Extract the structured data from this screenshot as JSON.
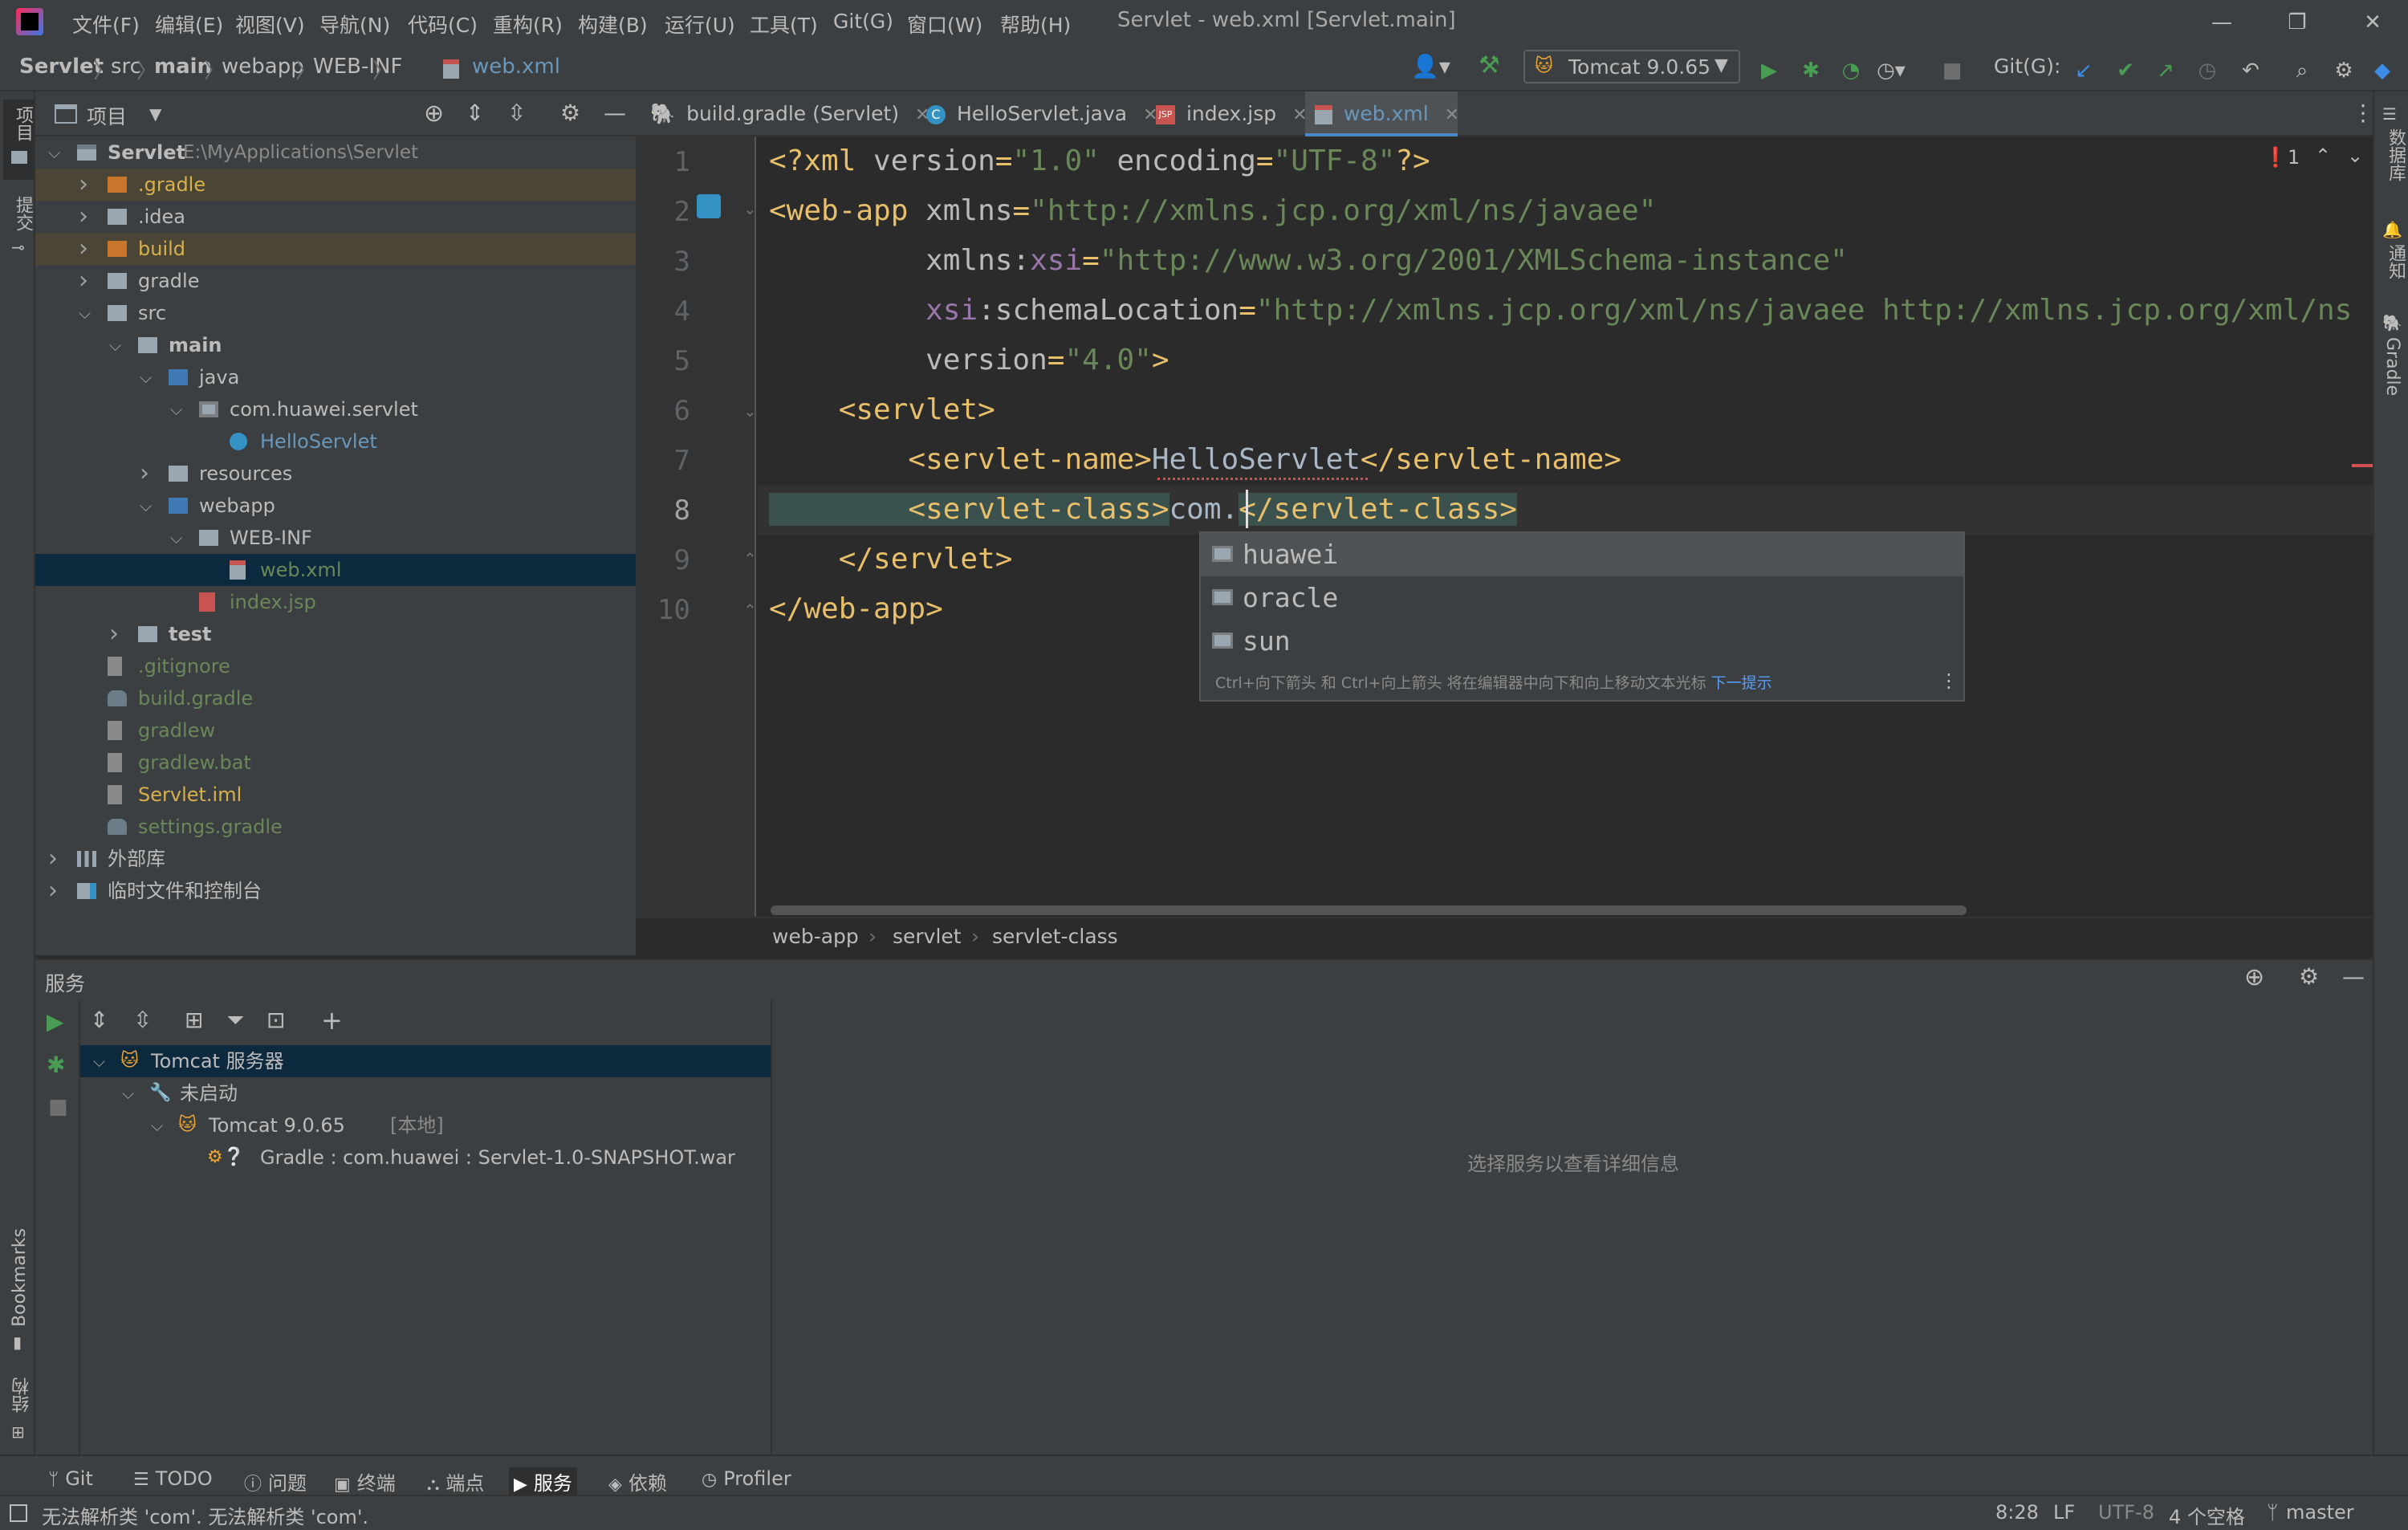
{
  "menu": {
    "items": [
      "文件(F)",
      "编辑(E)",
      "视图(V)",
      "导航(N)",
      "代码(C)",
      "重构(R)",
      "构建(B)",
      "运行(U)",
      "工具(T)",
      "Git(G)",
      "窗口(W)",
      "帮助(H)"
    ],
    "window_title": "Servlet - web.xml [Servlet.main]"
  },
  "navbar": {
    "breadcrumbs": [
      "Servlet",
      "src",
      "main",
      "webapp",
      "WEB-INF",
      "web.xml"
    ],
    "run_config": "Tomcat 9.0.65",
    "git_label": "Git(G):"
  },
  "project": {
    "title": "项目",
    "tree": [
      {
        "label": "Servlet",
        "path": "E:\\MyApplications\\Servlet"
      },
      {
        "label": ".gradle"
      },
      {
        "label": ".idea"
      },
      {
        "label": "build"
      },
      {
        "label": "gradle"
      },
      {
        "label": "src"
      },
      {
        "label": "main"
      },
      {
        "label": "java"
      },
      {
        "label": "com.huawei.servlet"
      },
      {
        "label": "HelloServlet"
      },
      {
        "label": "resources"
      },
      {
        "label": "webapp"
      },
      {
        "label": "WEB-INF"
      },
      {
        "label": "web.xml"
      },
      {
        "label": "index.jsp"
      },
      {
        "label": "test"
      },
      {
        "label": ".gitignore"
      },
      {
        "label": "build.gradle"
      },
      {
        "label": "gradlew"
      },
      {
        "label": "gradlew.bat"
      },
      {
        "label": "Servlet.iml"
      },
      {
        "label": "settings.gradle"
      },
      {
        "label": "外部库"
      },
      {
        "label": "临时文件和控制台"
      }
    ]
  },
  "editor": {
    "tabs": [
      "build.gradle (Servlet)",
      "HelloServlet.java",
      "index.jsp",
      "web.xml"
    ],
    "active_tab": "web.xml",
    "error_count": "1",
    "lines": [
      {
        "n": "1",
        "parts": [
          [
            "t",
            "<?xml "
          ],
          [
            "a",
            "version"
          ],
          [
            "t",
            "="
          ],
          [
            "s",
            "\"1.0\""
          ],
          [
            "a",
            " encoding"
          ],
          [
            "t",
            "="
          ],
          [
            "s",
            "\"UTF-8\""
          ],
          [
            "t",
            "?>"
          ]
        ]
      },
      {
        "n": "2",
        "parts": [
          [
            "t",
            "<web-app "
          ],
          [
            "a",
            "xmlns"
          ],
          [
            "t",
            "="
          ],
          [
            "s",
            "\"http://xmlns.jcp.org/xml/ns/javaee\""
          ]
        ]
      },
      {
        "n": "3",
        "parts": [
          [
            "a",
            "         xmlns:"
          ],
          [
            "n",
            "xsi"
          ],
          [
            "t",
            "="
          ],
          [
            "s",
            "\"http://www.w3.org/2001/XMLSchema-instance\""
          ]
        ]
      },
      {
        "n": "4",
        "parts": [
          [
            "n",
            "         xsi"
          ],
          [
            "a",
            ":schemaLocation"
          ],
          [
            "t",
            "="
          ],
          [
            "s",
            "\"http://xmlns.jcp.org/xml/ns/javaee http://xmlns.jcp.org/xml/ns"
          ]
        ]
      },
      {
        "n": "5",
        "parts": [
          [
            "a",
            "         version"
          ],
          [
            "t",
            "="
          ],
          [
            "s",
            "\"4.0\""
          ],
          [
            "t",
            ">"
          ]
        ]
      },
      {
        "n": "6",
        "parts": [
          [
            "t",
            "    <servlet>"
          ]
        ]
      },
      {
        "n": "7",
        "parts": [
          [
            "t",
            "        <servlet-name>"
          ],
          [
            "x",
            "HelloServlet"
          ],
          [
            "t",
            "</servlet-name>"
          ]
        ]
      },
      {
        "n": "8",
        "parts": [
          [
            "t",
            "        <servlet-class>"
          ],
          [
            "x",
            "com."
          ],
          [
            "t",
            "</servlet-class>"
          ]
        ]
      },
      {
        "n": "9",
        "parts": [
          [
            "t",
            "    </servlet>"
          ]
        ]
      },
      {
        "n": "10",
        "parts": [
          [
            "t",
            "</web-app>"
          ]
        ]
      }
    ],
    "completion": {
      "items": [
        "huawei",
        "oracle",
        "sun"
      ],
      "hint": "Ctrl+向下箭头 和 Ctrl+向上箭头 将在编辑器中向下和向上移动文本光标",
      "hint_link": "下一提示"
    },
    "breadcrumbs": [
      "web-app",
      "servlet",
      "servlet-class"
    ]
  },
  "services": {
    "title": "服务",
    "tree": [
      {
        "label": "Tomcat 服务器"
      },
      {
        "label": "未启动"
      },
      {
        "label": "Tomcat 9.0.65",
        "suffix": "[本地]"
      },
      {
        "label": "Gradle : com.huawei : Servlet-1.0-SNAPSHOT.war"
      }
    ],
    "empty_text": "选择服务以查看详细信息"
  },
  "left_strip": {
    "project": "项目",
    "commit": "提交",
    "bookmarks": "Bookmarks",
    "structure": "结构"
  },
  "right_strip": {
    "database": "数据库",
    "notifications": "通知",
    "gradle": "Gradle"
  },
  "toolwindows": [
    "Git",
    "TODO",
    "问题",
    "终端",
    "端点",
    "服务",
    "依赖",
    "Profiler"
  ],
  "status": {
    "message": "无法解析类 'com'. 无法解析类 'com'.",
    "position": "8:28",
    "line_sep": "LF",
    "encoding": "UTF-8",
    "indent": "4 个空格",
    "branch": "master"
  },
  "colors": {
    "accent": "#4a88c7",
    "selection": "#0d293e",
    "tag": "#e8bf6a",
    "string": "#6a8759",
    "attr_ns": "#9876aa",
    "run_green": "#499c54"
  }
}
